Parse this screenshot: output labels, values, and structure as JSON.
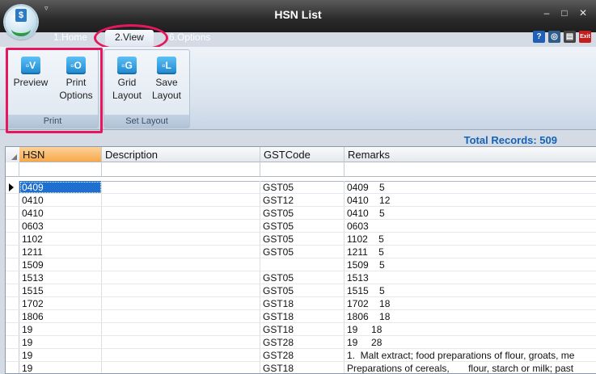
{
  "window": {
    "title": "HSN List",
    "minimize": "–",
    "maximize": "□",
    "close": "✕",
    "qa_arrow": "▿"
  },
  "tabs": [
    {
      "label": "1.Home"
    },
    {
      "label": "2.View"
    },
    {
      "label": "6.Options"
    }
  ],
  "help_icons": [
    {
      "name": "help-icon",
      "glyph": "?",
      "color": "#1f5fb8"
    },
    {
      "name": "support-icon",
      "glyph": "◎",
      "color": "#2e5d8c"
    },
    {
      "name": "document-icon",
      "glyph": "▤",
      "color": "#444444"
    },
    {
      "name": "exit-icon",
      "glyph": "Exit",
      "color": "#c41d1d"
    }
  ],
  "ribbon": {
    "groups": [
      {
        "label": "Print",
        "buttons": [
          {
            "icon_letter": "V",
            "label_lines": [
              "Preview"
            ]
          },
          {
            "icon_letter": "O",
            "label_lines": [
              "Print",
              "Options"
            ]
          }
        ]
      },
      {
        "label": "Set Layout",
        "buttons": [
          {
            "icon_letter": "G",
            "label_lines": [
              "Grid",
              "Layout"
            ]
          },
          {
            "icon_letter": "L",
            "label_lines": [
              "Save",
              "Layout"
            ]
          }
        ]
      }
    ]
  },
  "total_records": "Total Records: 509",
  "grid": {
    "columns": [
      "HSN",
      "Description",
      "GSTCode",
      "Remarks"
    ],
    "rows": [
      [
        "0409",
        "",
        "GST05",
        "0409    5"
      ],
      [
        "0410",
        "",
        "GST12",
        "0410    12"
      ],
      [
        "0410",
        "",
        "GST05",
        "0410    5"
      ],
      [
        "0603",
        "",
        "GST05",
        "0603"
      ],
      [
        "1102",
        "",
        "GST05",
        "1102    5"
      ],
      [
        "1211",
        "",
        "GST05",
        "1211    5"
      ],
      [
        "1509",
        "",
        "",
        "1509    5"
      ],
      [
        "1513",
        "",
        "GST05",
        "1513"
      ],
      [
        "1515",
        "",
        "GST05",
        "1515    5"
      ],
      [
        "1702",
        "",
        "GST18",
        "1702    18"
      ],
      [
        "1806",
        "",
        "GST18",
        "1806    18"
      ],
      [
        "19",
        "",
        "GST18",
        "19     18"
      ],
      [
        "19",
        "",
        "GST28",
        "19     28"
      ],
      [
        "19",
        "",
        "GST28",
        "1.  Malt extract; food preparations of flour, groats, me"
      ],
      [
        "19",
        "",
        "GST18",
        "Preparations of cereals,       flour, starch or milk; past"
      ]
    ],
    "selected_row": 0
  },
  "colors": {
    "highlight": "#e8175d",
    "selection": "#1f6fd0",
    "total": "#1463b8"
  }
}
